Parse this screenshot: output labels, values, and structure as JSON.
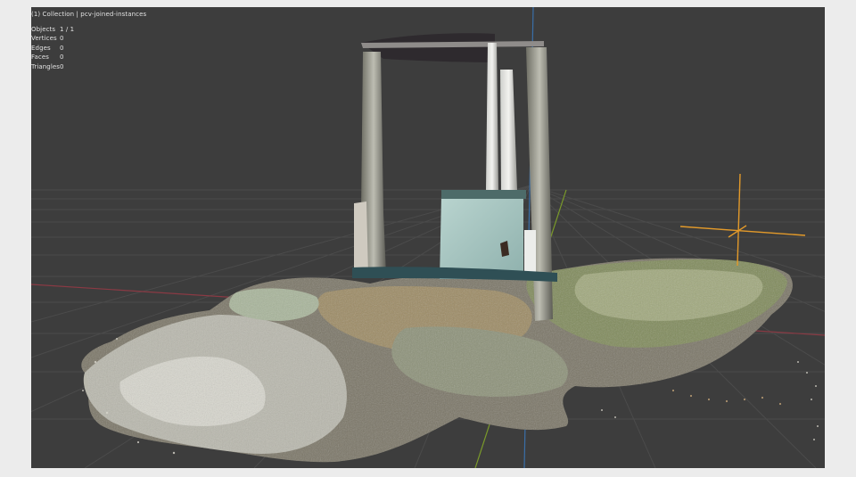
{
  "viewport": {
    "header": "(1) Collection | pcv-joined-instances",
    "stats": [
      {
        "label": "Objects",
        "value": "1 / 1"
      },
      {
        "label": "Vertices",
        "value": "0"
      },
      {
        "label": "Edges",
        "value": "0"
      },
      {
        "label": "Faces",
        "value": "0"
      },
      {
        "label": "Triangles",
        "value": "0"
      }
    ]
  },
  "colors": {
    "background": "#3d3d3d",
    "grid": "#4a4a4a",
    "x_axis": "#8a3a44",
    "y_axis": "#7a9a2a",
    "z_axis": "#3a6fa8",
    "cursor": "#e39a2a"
  }
}
